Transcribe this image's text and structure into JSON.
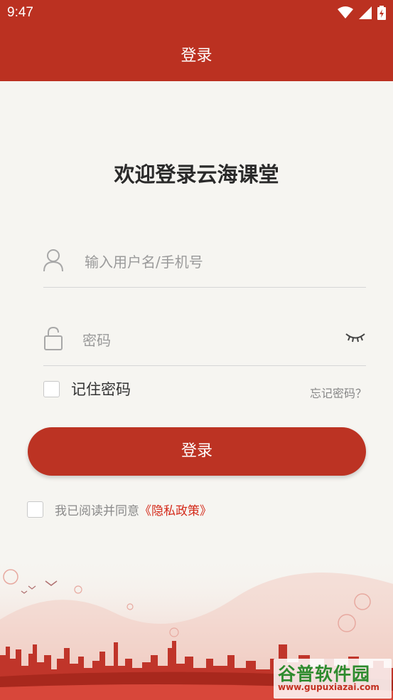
{
  "status_bar": {
    "time": "9:47"
  },
  "app_bar": {
    "title": "登录"
  },
  "welcome": "欢迎登录云海课堂",
  "username": {
    "placeholder": "输入用户名/手机号"
  },
  "password": {
    "placeholder": "密码"
  },
  "remember": {
    "label": "记住密码",
    "checked": false
  },
  "forgot": "忘记密码？",
  "login_button": "登录",
  "agreement": {
    "text": "我已阅读并同意",
    "link": "《隐私政策》",
    "checked": false
  },
  "watermark": {
    "title": "谷普软件园",
    "url": "www.gupuxiazai.com"
  },
  "colors": {
    "primary": "#bb3121",
    "background": "#f6f5f1",
    "link": "#d42a1a"
  },
  "icons": [
    "wifi-icon",
    "signal-icon",
    "battery-icon",
    "user-icon",
    "lock-icon",
    "eye-closed-icon"
  ]
}
